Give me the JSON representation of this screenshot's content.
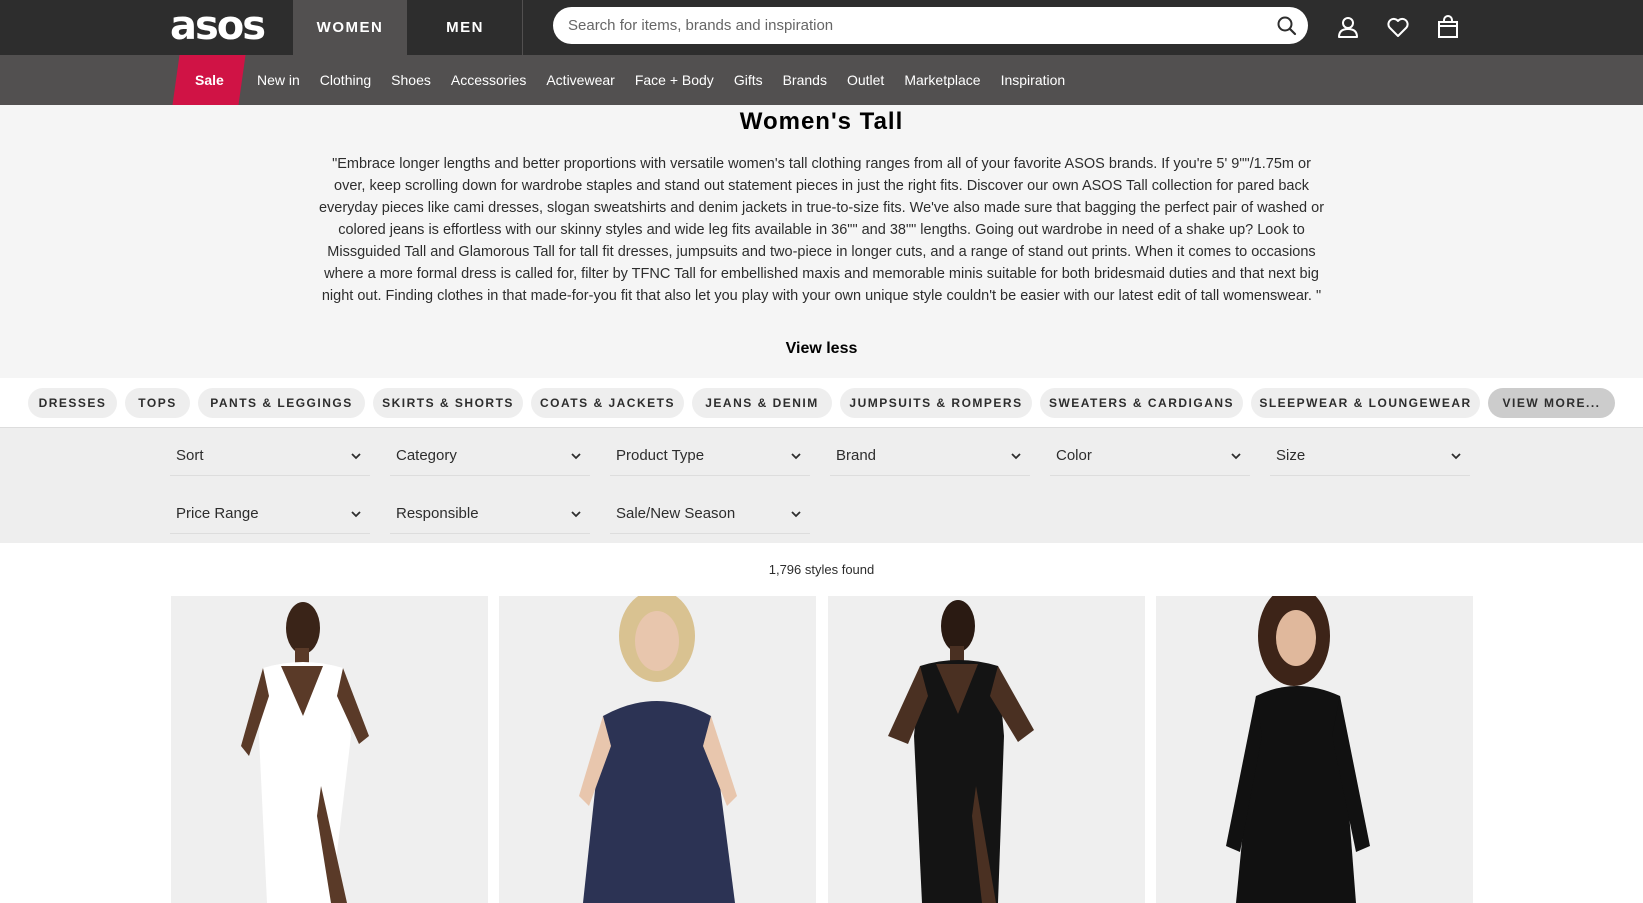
{
  "header": {
    "logo": "asos",
    "tabs": [
      "WOMEN",
      "MEN"
    ],
    "search": {
      "placeholder": "Search for items, brands and inspiration"
    },
    "icons": [
      "search-icon",
      "account-icon",
      "heart-icon",
      "bag-icon"
    ]
  },
  "nav": {
    "sale": "Sale",
    "items": [
      "New in",
      "Clothing",
      "Shoes",
      "Accessories",
      "Activewear",
      "Face + Body",
      "Gifts",
      "Brands",
      "Outlet",
      "Marketplace",
      "Inspiration"
    ]
  },
  "page": {
    "title": "Women's Tall",
    "description": "\"Embrace longer lengths and better proportions with versatile women's tall clothing ranges from all of your favorite ASOS brands. If you're 5' 9\"\"/1.75m or over, keep scrolling down for wardrobe staples and stand out statement pieces in just the right fits. Discover our own ASOS Tall collection for pared back everyday pieces like cami dresses, slogan sweatshirts and denim jackets in true-to-size fits. We've also made sure that bagging the perfect pair of washed or colored jeans is effortless with our skinny styles and wide leg fits available in 36\"\" and 38\"\" lengths. Going out wardrobe in need of a shake up? Look to Missguided Tall and Glamorous Tall for tall fit dresses, jumpsuits and two-piece in longer cuts, and a range of stand out prints. When it comes to occasions where a more formal dress is called for, filter by TFNC Tall for embellished maxis and memorable minis suitable for both bridesmaid duties and that next big night out. Finding clothes in that made-for-you fit that also let you play with your own unique style couldn't be easier with our latest edit of tall womenswear. \"",
    "view_less": "View less"
  },
  "chips": [
    "DRESSES",
    "TOPS",
    "PANTS & LEGGINGS",
    "SKIRTS & SHORTS",
    "COATS & JACKETS",
    "JEANS & DENIM",
    "JUMPSUITS & ROMPERS",
    "SWEATERS & CARDIGANS",
    "SLEEPWEAR & LOUNGEWEAR",
    "VIEW MORE..."
  ],
  "filters": [
    "Sort",
    "Category",
    "Product Type",
    "Brand",
    "Color",
    "Size",
    "Price Range",
    "Responsible",
    "Sale/New Season"
  ],
  "results": {
    "count_text": "1,796 styles found"
  },
  "colors": {
    "topbar": "#2d2d2d",
    "navbar": "#525050",
    "sale": "#d01345"
  }
}
